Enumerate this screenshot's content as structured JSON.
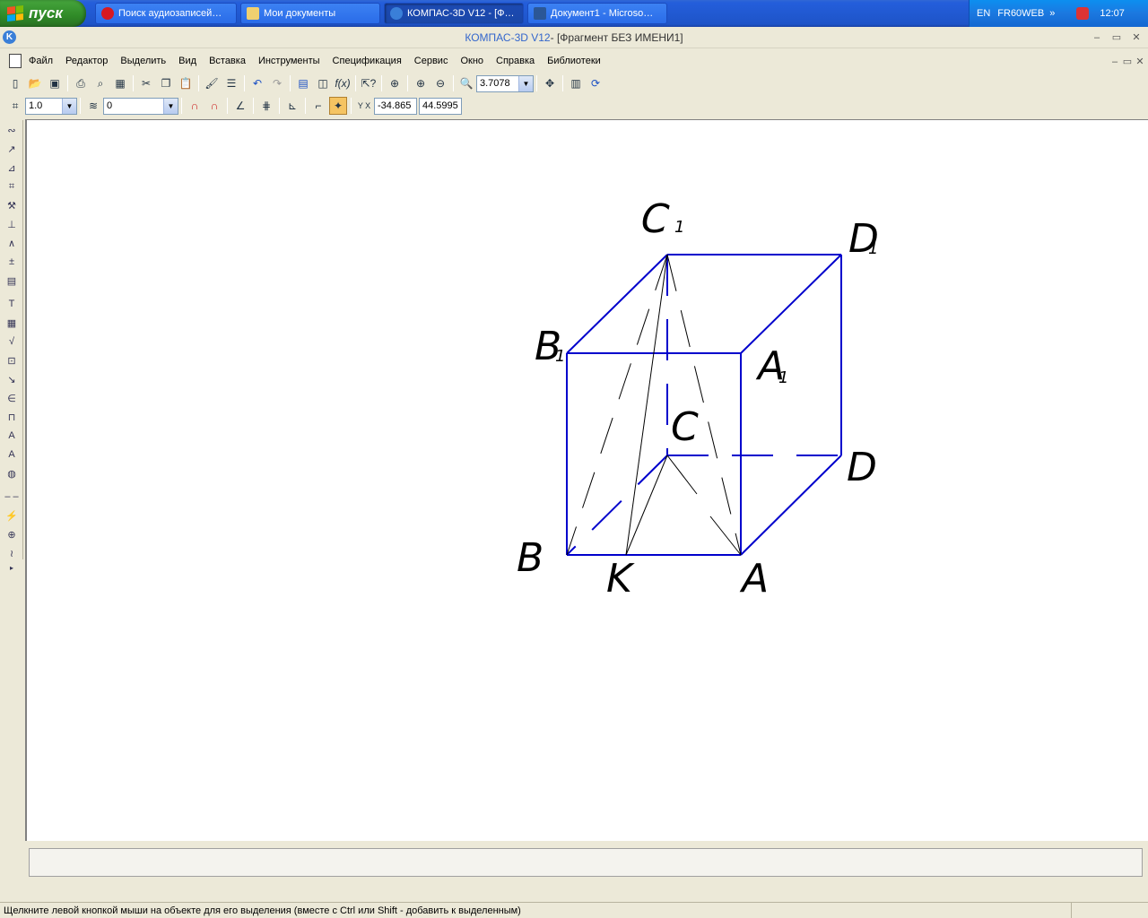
{
  "taskbar": {
    "start_label": "пуск",
    "tasks": [
      {
        "label": "Поиск аудиозаписей…",
        "icon": "opera-icon",
        "color": "#d71920"
      },
      {
        "label": "Мои документы",
        "icon": "folder-icon",
        "color": "#f0d070"
      },
      {
        "label": "КОМПАС-3D V12 - [Ф…",
        "icon": "kompas-icon",
        "color": "#3a7fd8"
      },
      {
        "label": "Документ1 - Microso…",
        "icon": "word-icon",
        "color": "#2b5797"
      }
    ],
    "tray": {
      "lang": "EN",
      "user": "FR60WEB",
      "more": "»",
      "time": "12:07"
    }
  },
  "window": {
    "app_name": "КОМПАС-3D V12",
    "doc_title": " - [Фрагмент БЕЗ ИМЕНИ1]",
    "minimize": "–",
    "maximize": "▭",
    "close": "✕",
    "app_icon_letter": "K"
  },
  "menu": {
    "items": [
      "Файл",
      "Редактор",
      "Выделить",
      "Вид",
      "Вставка",
      "Инструменты",
      "Спецификация",
      "Сервис",
      "Окно",
      "Справка",
      "Библиотеки"
    ]
  },
  "toolbar1": {
    "zoom_value": "3.7078"
  },
  "toolbar2": {
    "scale_value": "1.0",
    "layer_value": "0",
    "coord_label": "Y X",
    "coord_x": "-34.865",
    "coord_y": "44.5995"
  },
  "drawing": {
    "labels": {
      "C1": "C",
      "C1_sub": "1",
      "D1": "D",
      "D1_sub": "1",
      "B1": "B",
      "B1_sub": "1",
      "A1": "A",
      "A1_sub": "1",
      "C": "C",
      "D": "D",
      "B": "B",
      "K": "K",
      "A": "A"
    },
    "line_color": "#0000cc"
  },
  "status": {
    "hint": "Щелкните левой кнопкой мыши на объекте для его выделения (вместе с Ctrl или Shift - добавить к выделенным)"
  }
}
